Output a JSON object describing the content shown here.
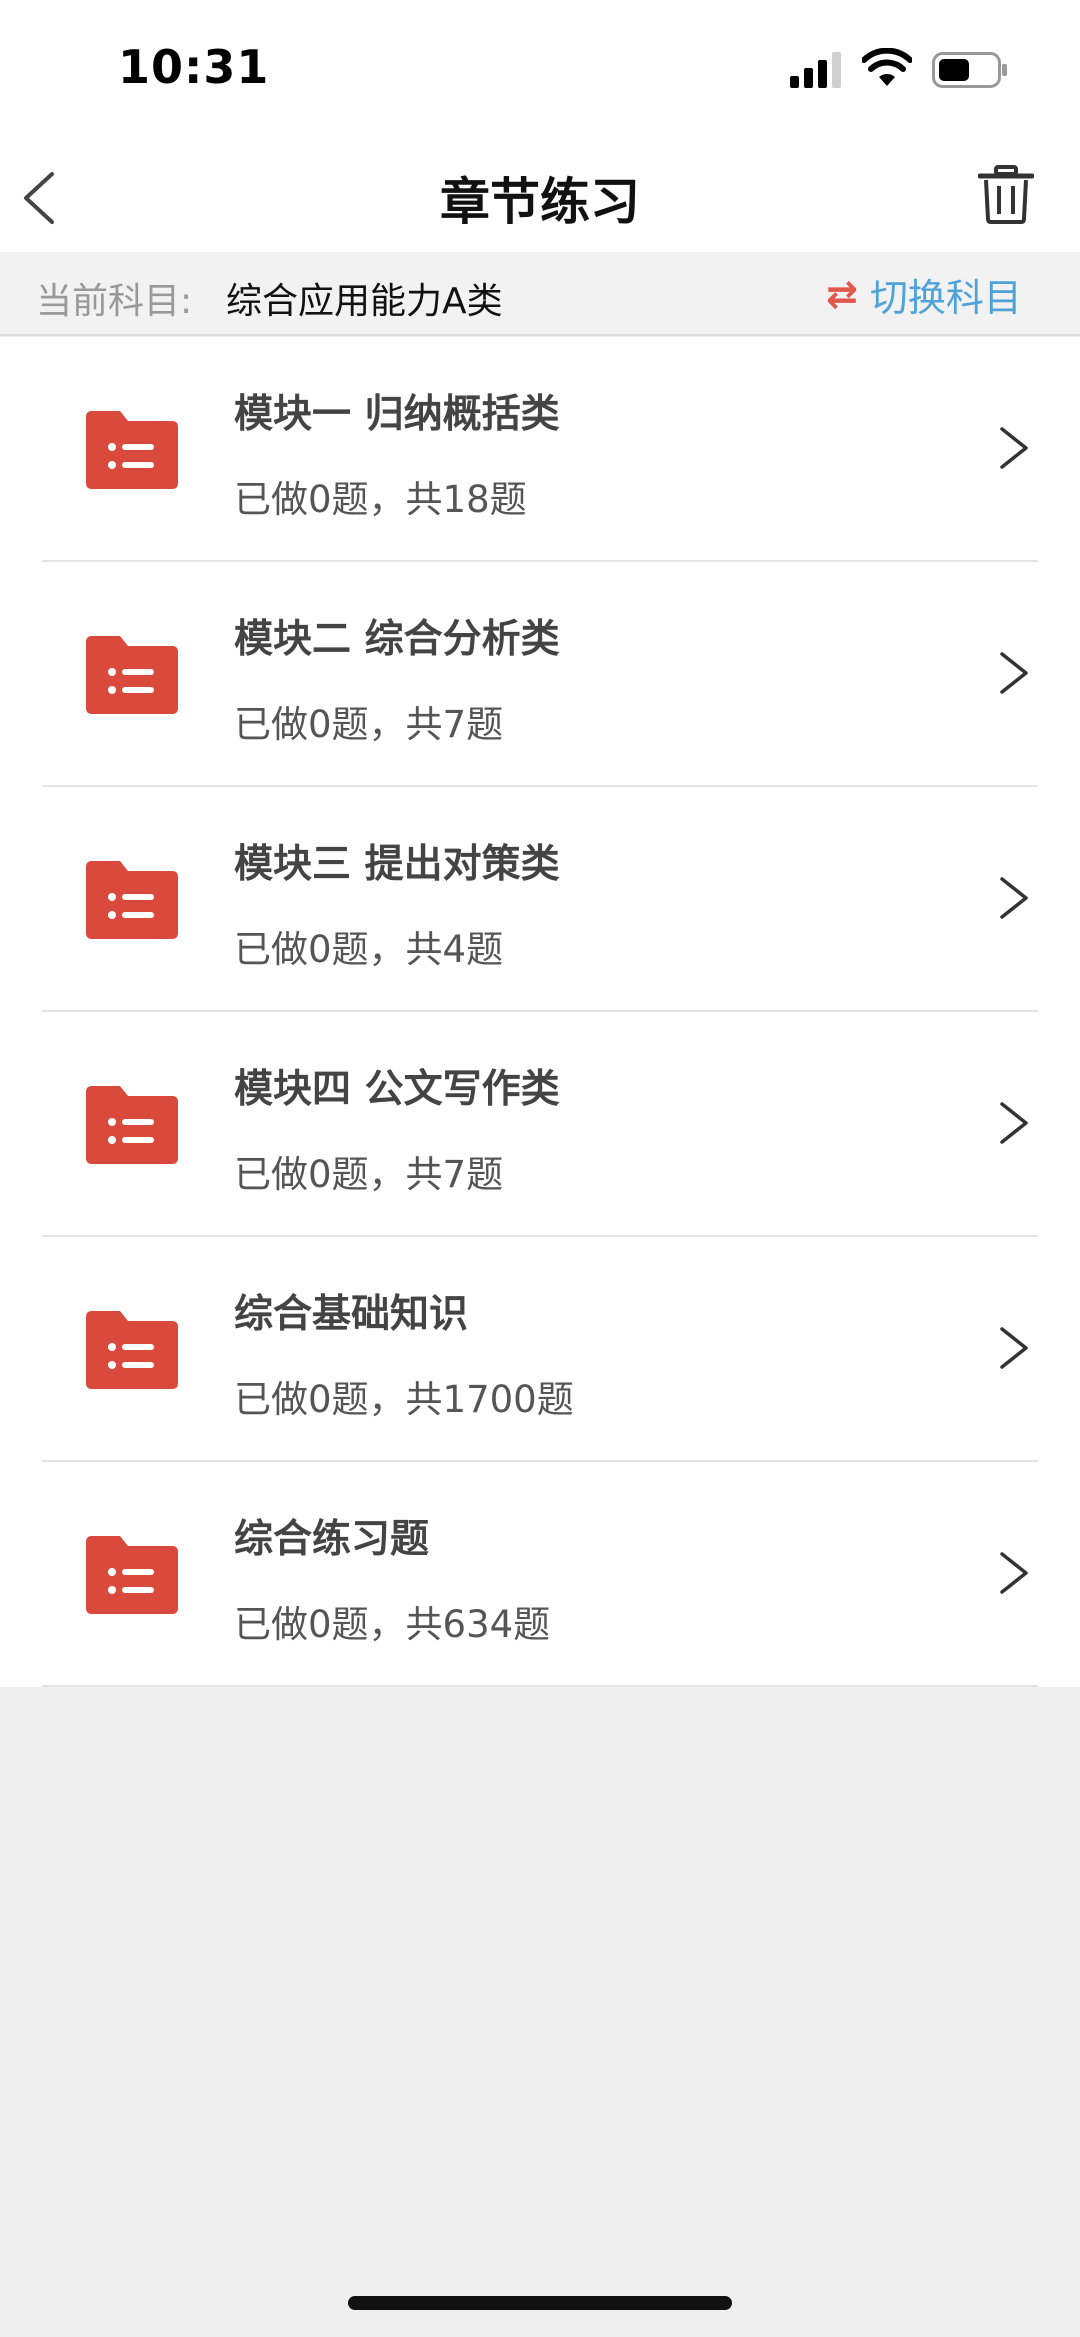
{
  "status_bar": {
    "time": "10:31",
    "icons": [
      "signal-icon",
      "wifi-icon",
      "battery-icon"
    ]
  },
  "header": {
    "title": "章节练习",
    "back_icon": "chevron-left-icon",
    "trash_icon": "trash-icon"
  },
  "subject": {
    "label": "当前科目:",
    "value": "综合应用能力A类",
    "switch_icon": "swap-arrows-icon",
    "switch_label": "切换科目"
  },
  "colors": {
    "accent_red": "#d94a3d",
    "link_blue": "#4fa3d9",
    "background": "#efefef"
  },
  "chapters": [
    {
      "title": "模块一 归纳概括类",
      "progress": "已做0题，共18题"
    },
    {
      "title": "模块二 综合分析类",
      "progress": "已做0题，共7题"
    },
    {
      "title": "模块三 提出对策类",
      "progress": "已做0题，共4题"
    },
    {
      "title": "模块四 公文写作类",
      "progress": "已做0题，共7题"
    },
    {
      "title": "综合基础知识",
      "progress": "已做0题，共1700题"
    },
    {
      "title": "综合练习题",
      "progress": "已做0题，共634题"
    }
  ]
}
